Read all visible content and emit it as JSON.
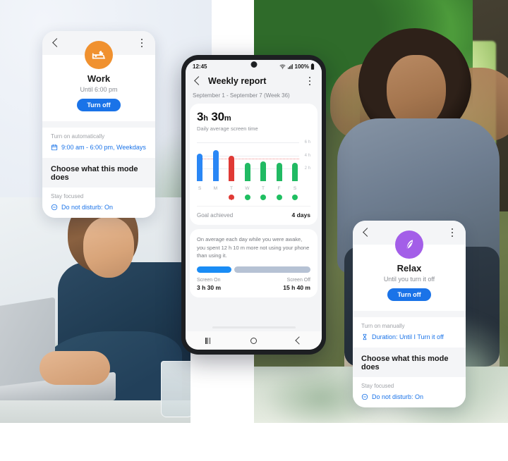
{
  "work_card": {
    "back_icon": "chevron-left-icon",
    "menu_icon": "kebab-menu-icon",
    "mode_icon": "bed-icon",
    "accent_color": "#f0912f",
    "title": "Work",
    "subtitle": "Until 6:00 pm",
    "button_label": "Turn off",
    "auto_section_label": "Turn on automatically",
    "schedule_icon": "calendar-icon",
    "schedule_text": "9:00 am - 6:00 pm, Weekdays",
    "choose_heading": "Choose what this mode does",
    "focus_label": "Stay focused",
    "dnd_icon": "do-not-disturb-icon",
    "dnd_text": "Do not disturb: On"
  },
  "relax_card": {
    "back_icon": "chevron-left-icon",
    "menu_icon": "kebab-menu-icon",
    "mode_icon": "leaf-icon",
    "accent_color": "#a35ee8",
    "title": "Relax",
    "subtitle": "Until you turn it off",
    "button_label": "Turn off",
    "manual_section_label": "Turn on manually",
    "duration_icon": "hourglass-icon",
    "duration_text": "Duration: Until I Turn it off",
    "choose_heading": "Choose what this mode does",
    "focus_label": "Stay focused",
    "dnd_icon": "do-not-disturb-icon",
    "dnd_text": "Do not disturb: On"
  },
  "phone": {
    "status_bar": {
      "time": "12:45",
      "wifi_icon": "wifi-icon",
      "signal_icon": "cellular-signal-icon",
      "battery_text": "100%",
      "battery_icon": "battery-full-icon"
    },
    "app_bar": {
      "back_icon": "chevron-left-icon",
      "title": "Weekly report",
      "menu_icon": "kebab-menu-icon"
    },
    "date_range": "September 1 - September 7 (Week 36)",
    "summary": {
      "value": "3 h 30 m",
      "value_hours": "3",
      "value_hours_unit": "h",
      "value_minutes": "30",
      "value_minutes_unit": "m",
      "caption": "Daily average screen time"
    },
    "goal_row": {
      "label": "Goal achieved",
      "value": "4 days"
    },
    "insight": {
      "text": "On average each day while you were awake, you spent 12 h 10 m more not using your phone than using it.",
      "screen_on_label": "Screen On",
      "screen_on_value": "3 h 30 m",
      "screen_off_label": "Screen Off",
      "screen_off_value": "15 h 40 m",
      "screen_on_percent": 31,
      "screen_off_percent": 69
    },
    "nav_bar": {
      "recents_icon": "recents-icon",
      "home_icon": "home-circle-icon",
      "back_icon": "back-chevron-icon"
    }
  },
  "chart_data": {
    "type": "bar",
    "title": "Daily screen time",
    "categories": [
      "S",
      "M",
      "T",
      "W",
      "T",
      "F",
      "S"
    ],
    "values": [
      4.3,
      4.8,
      3.9,
      2.9,
      3.1,
      2.8,
      2.9
    ],
    "bar_colors": [
      "#2a87f5",
      "#2a87f5",
      "#e03a35",
      "#21ba63",
      "#21ba63",
      "#21ba63",
      "#21ba63"
    ],
    "status": [
      "none",
      "none",
      "missed",
      "achieved",
      "achieved",
      "achieved",
      "achieved"
    ],
    "status_icons": [
      "",
      "",
      "cross-icon",
      "check-icon",
      "check-icon",
      "check-icon",
      "check-icon"
    ],
    "ylabel": "",
    "xlabel": "",
    "ylim": [
      0,
      6.8
    ],
    "yticks": [
      2,
      4,
      6
    ],
    "ytick_labels": [
      "2 h",
      "4 h",
      "6 h"
    ],
    "goal_line": 3.5,
    "goal_line_color": "#f08a8a",
    "grid": true,
    "legend": "none"
  }
}
